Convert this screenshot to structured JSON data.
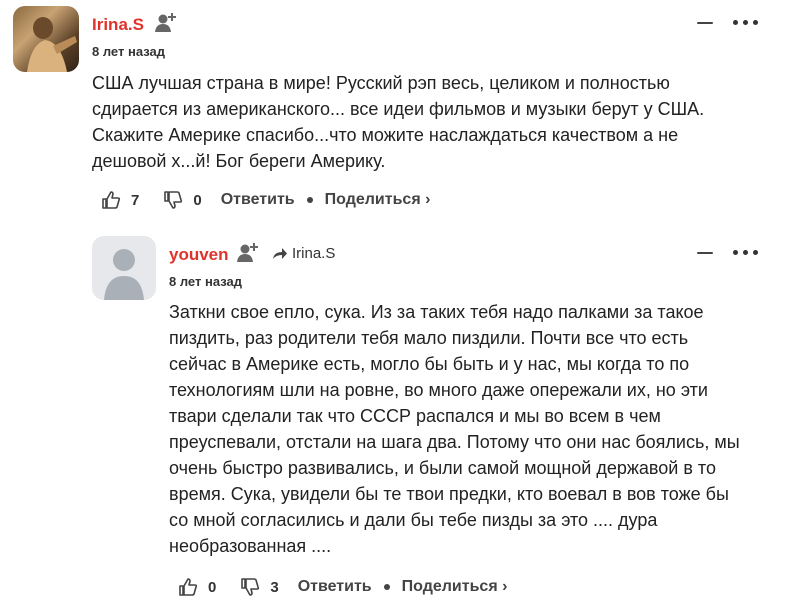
{
  "comments": [
    {
      "author": "Irina.S",
      "time": "8 лет назад",
      "text": "США лучшая страна в мире! Русский рэп весь, целиком и полностью\nсдирается из американского... все идеи фильмов и музыки берут у США.\nСкажите Америке спасибо...что можите наслаждаться качеством а не\nдешовой х...й! Бог береги Америку.",
      "likes": "7",
      "dislikes": "0",
      "reply_label": "Ответить",
      "share_label": "Поделиться ›"
    },
    {
      "author": "youven",
      "reply_to": "Irina.S",
      "time": "8 лет назад",
      "text": "Заткни свое епло, сука. Из за таких тебя надо палками за такое\nпиздить, раз родители тебя мало пиздили. Почти все что есть\nсейчас в Америке есть, могло бы быть и у нас, мы когда то по\nтехнологиям шли на ровне, во много даже опережали их, но эти\nтвари сделали так что СССР распался и мы во всем в чем\nпреуспевали, отстали на шага два. Потому что они нас боялись, мы\nочень быстро развивались, и были самой мощной державой в то\nвремя. Сука, увидели бы те твои предки, кто воевал в вов тоже бы\nсо мной согласились и дали бы тебе пизды за это .... дура\nнеобразованная ....",
      "likes": "0",
      "dislikes": "3",
      "reply_label": "Ответить",
      "share_label": "Поделиться ›"
    }
  ],
  "colors": {
    "author": "#e0332b",
    "text": "#222222"
  }
}
